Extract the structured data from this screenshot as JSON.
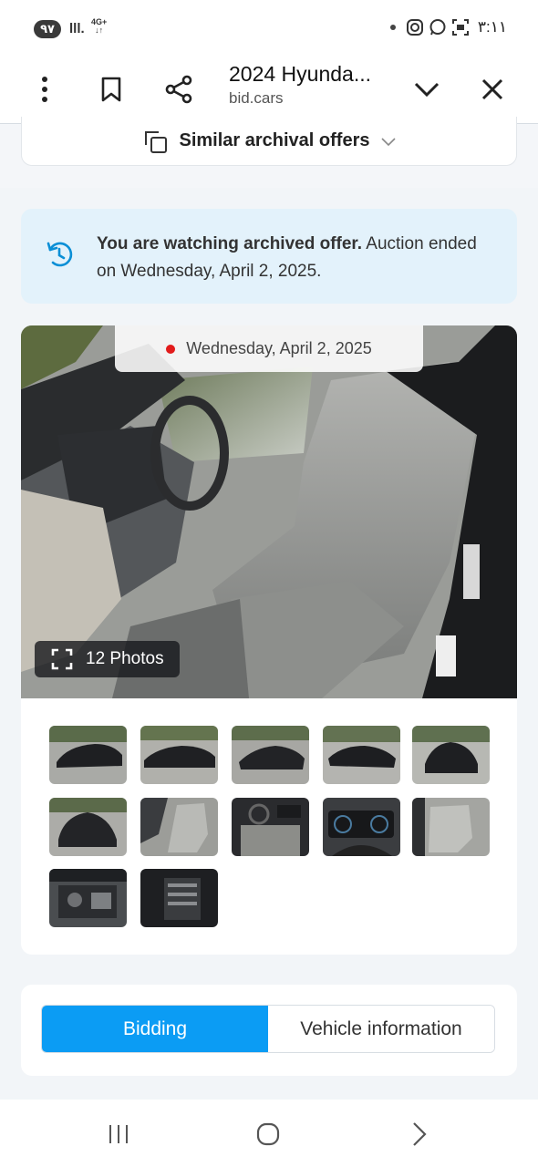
{
  "status_bar": {
    "badge": "٩٧",
    "signal": "lll.",
    "network": "4G+",
    "network_arrows": "↓↑",
    "time": "٣:١١"
  },
  "browser": {
    "title": "2024 Hyunda...",
    "url": "bid.cars",
    "icons": [
      "menu-dots-icon",
      "bookmark-icon",
      "share-icon",
      "chevron-down-icon",
      "close-icon"
    ]
  },
  "similar": {
    "label": "Similar archival offers"
  },
  "notice": {
    "bold": "You are watching archived offer.",
    "text": " Auction ended on Wednesday, April 2, 2025."
  },
  "gallery": {
    "date": "Wednesday, April 2, 2025",
    "photos_label": "12 Photos",
    "thumbnails": [
      "exterior-front-left",
      "exterior-side",
      "exterior-rear-damaged",
      "exterior-front-right",
      "exterior-front",
      "exterior-rear",
      "interior-driver-seat",
      "interior-dashboard",
      "instrument-cluster",
      "interior-rear-seat",
      "engine-bay",
      "door-sticker"
    ]
  },
  "tabs": {
    "bidding": "Bidding",
    "vehicle_info": "Vehicle information",
    "active": "bidding"
  },
  "colors": {
    "accent": "#0b9cf4",
    "notice_bg": "#e3f2fb",
    "live_dot": "#e21b1b"
  }
}
